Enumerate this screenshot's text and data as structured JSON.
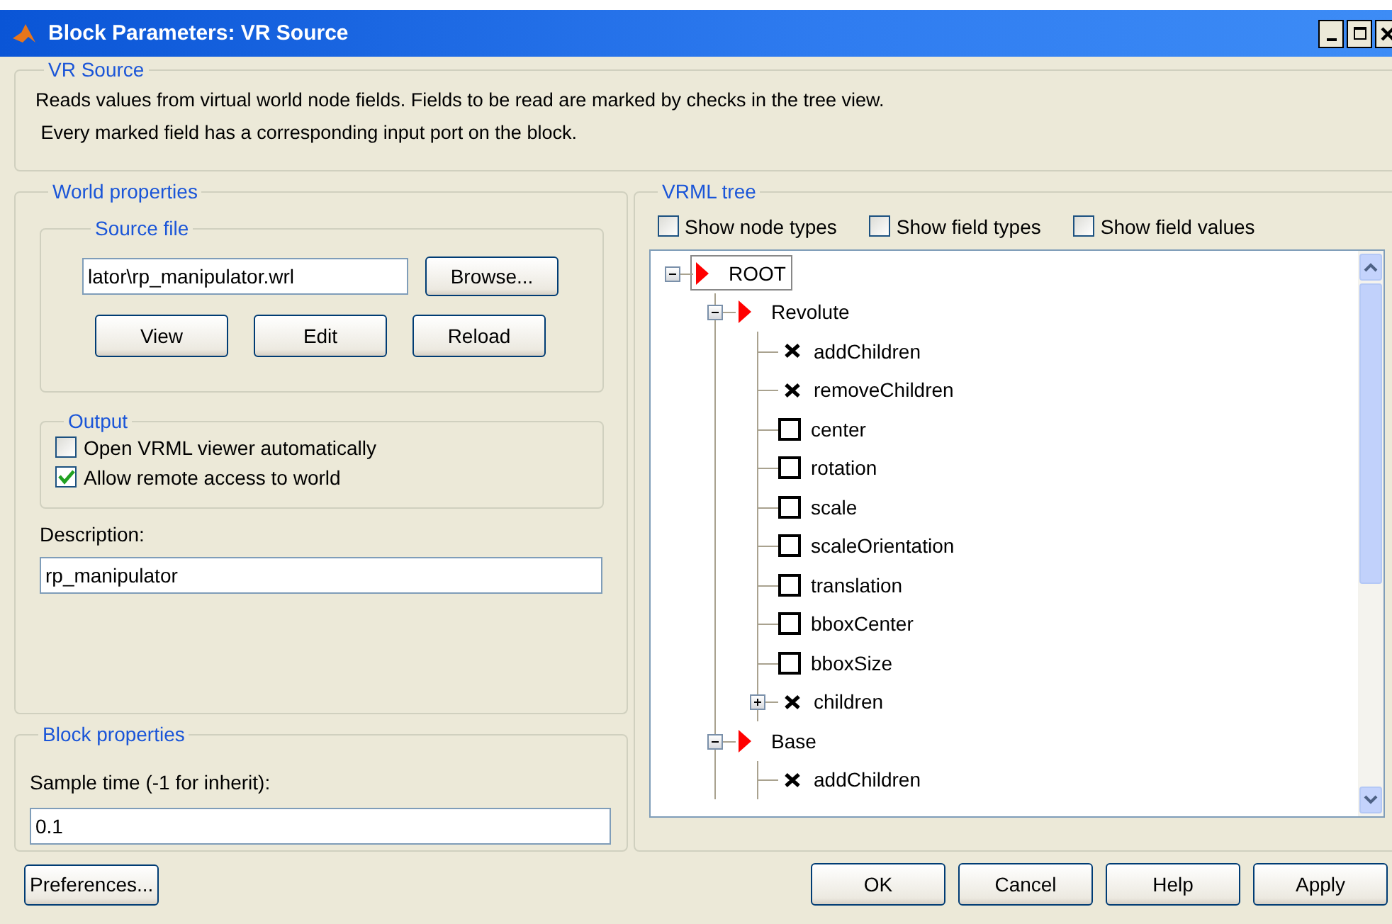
{
  "window": {
    "title": "Block Parameters: VR Source"
  },
  "block_info": {
    "title": "VR Source",
    "description": [
      "Reads values from virtual world node fields. Fields to be read are marked by checks in the tree view.",
      " Every marked field has a corresponding input port on the block."
    ]
  },
  "world_properties": {
    "title": "World properties",
    "source_file": {
      "title": "Source file",
      "path": "lator\\rp_manipulator.wrl",
      "browse": "Browse...",
      "buttons": [
        "View",
        "Edit",
        "Reload"
      ]
    },
    "output": {
      "title": "Output",
      "options": [
        {
          "label": "Open VRML viewer automatically",
          "checked": false
        },
        {
          "label": "Allow remote access to world",
          "checked": true
        }
      ]
    },
    "description": {
      "label": "Description:",
      "value": "rp_manipulator"
    }
  },
  "block_properties": {
    "title": "Block properties",
    "sample_time": {
      "label": "Sample time (-1 for inherit):",
      "value": "0.1"
    }
  },
  "vrml_tree": {
    "title": "VRML tree",
    "options": [
      {
        "label": "Show node types",
        "checked": false
      },
      {
        "label": "Show field types",
        "checked": false
      },
      {
        "label": "Show field values",
        "checked": false
      }
    ],
    "tree": [
      {
        "label": "ROOT",
        "kind": "node",
        "expanded": true,
        "selected": true,
        "children": [
          {
            "label": "Revolute",
            "kind": "node",
            "expanded": true,
            "selected": false,
            "children": [
              {
                "label": "addChildren",
                "kind": "event",
                "selected": false
              },
              {
                "label": "removeChildren",
                "kind": "event",
                "selected": false
              },
              {
                "label": "center",
                "kind": "field",
                "checked": false,
                "selected": false
              },
              {
                "label": "rotation",
                "kind": "field",
                "checked": false,
                "selected": false
              },
              {
                "label": "scale",
                "kind": "field",
                "checked": false,
                "selected": false
              },
              {
                "label": "scaleOrientation",
                "kind": "field",
                "checked": false,
                "selected": false
              },
              {
                "label": "translation",
                "kind": "field",
                "checked": false,
                "selected": false
              },
              {
                "label": "bboxCenter",
                "kind": "field",
                "checked": false,
                "selected": false
              },
              {
                "label": "bboxSize",
                "kind": "field",
                "checked": false,
                "selected": false
              },
              {
                "label": "children",
                "kind": "event",
                "expanded": false,
                "selected": false
              }
            ]
          },
          {
            "label": "Base",
            "kind": "node",
            "expanded": true,
            "selected": false,
            "children": [
              {
                "label": "addChildren",
                "kind": "event",
                "selected": false
              }
            ]
          }
        ]
      }
    ]
  },
  "preferences_button": "Preferences...",
  "dialog_buttons": [
    "OK",
    "Cancel",
    "Help",
    "Apply"
  ]
}
